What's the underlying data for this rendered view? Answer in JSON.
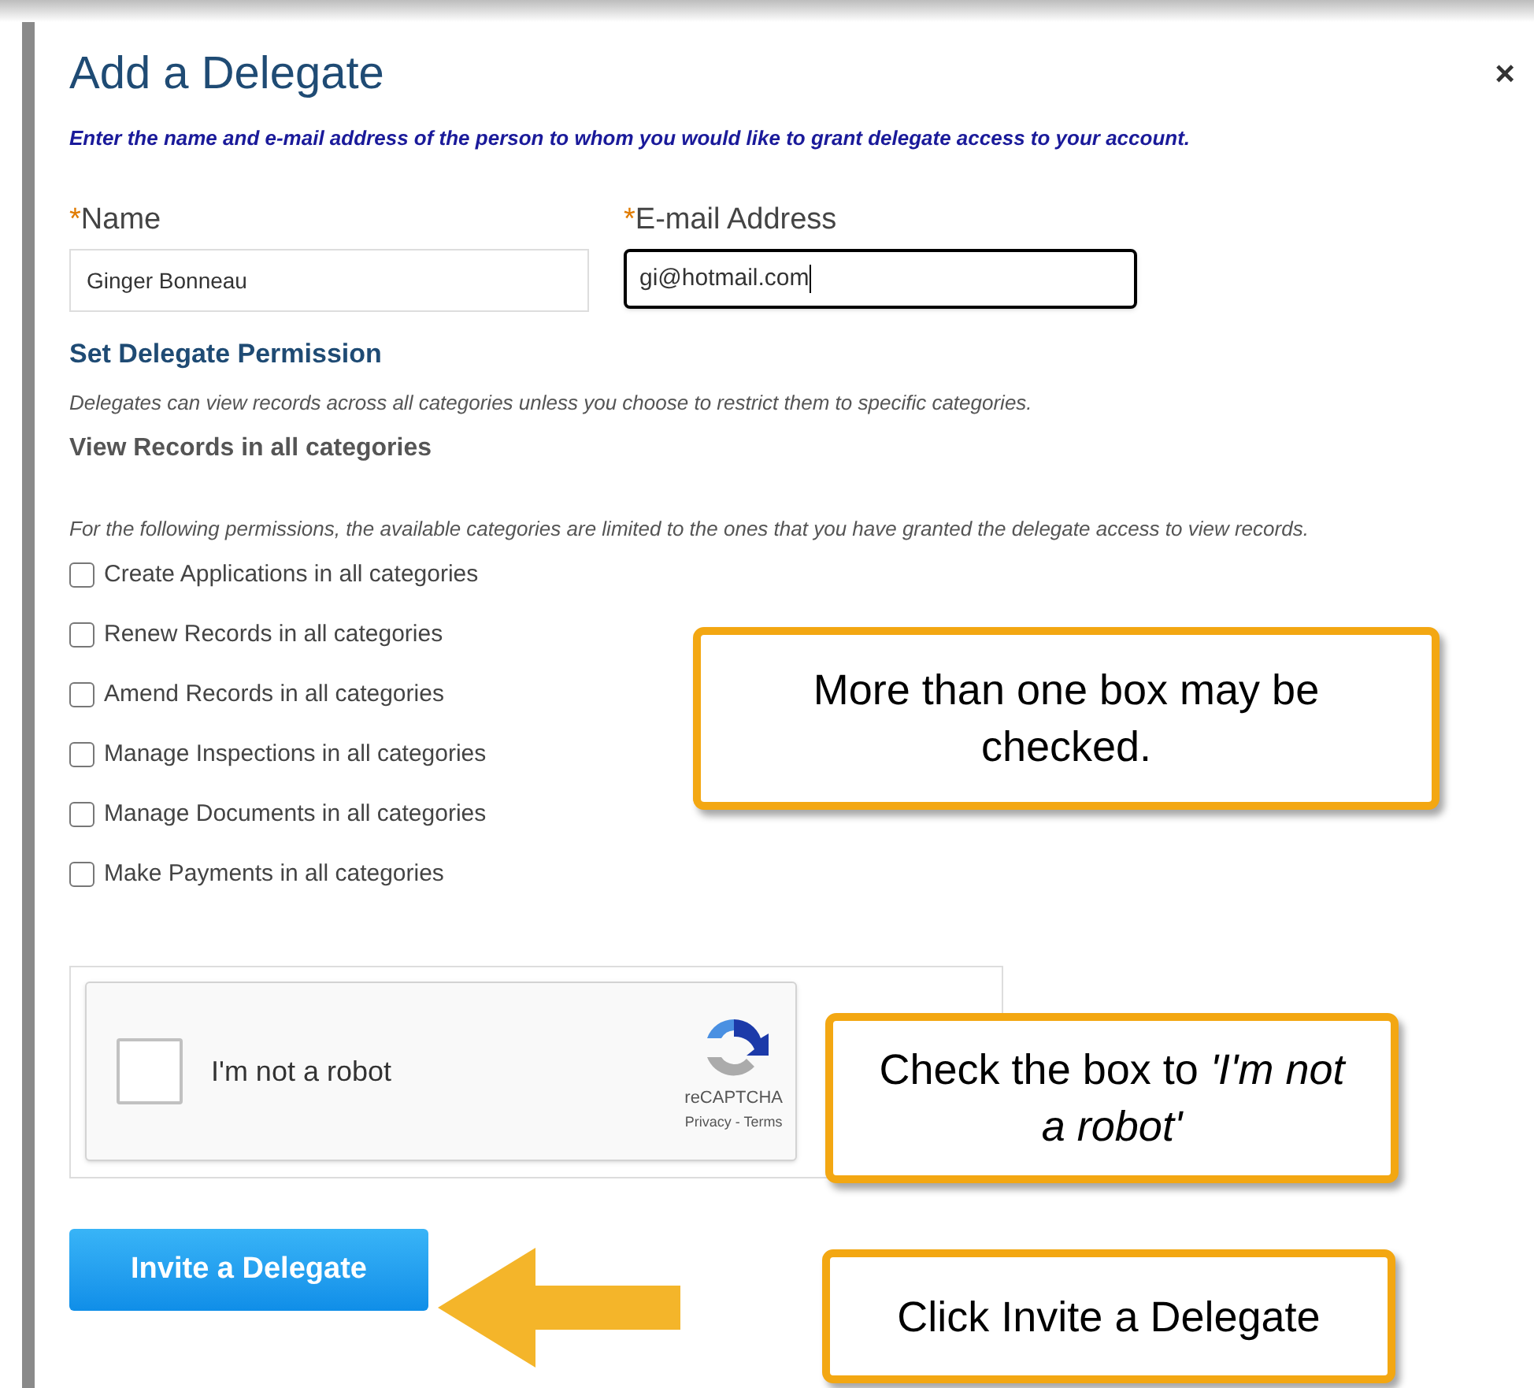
{
  "dialog": {
    "title": "Add a Delegate",
    "close": "×",
    "intro": "Enter the name and e-mail address of the person to whom you would like to grant delegate access to your account.",
    "fields": [
      {
        "label": "Name",
        "required_mark": "*",
        "value": "Ginger Bonneau",
        "focused": false
      },
      {
        "label": "E-mail Address",
        "required_mark": "*",
        "value": "gi@hotmail.com",
        "focused": true
      }
    ],
    "permission_heading": "Set Delegate Permission",
    "permission_note": "Delegates can view records across all categories unless you choose to restrict them to specific categories.",
    "view_records": "View Records in all categories",
    "following_note": "For the following permissions, the available categories are limited to the ones that you have granted the delegate access to view records.",
    "permissions": [
      {
        "label": "Create Applications in all categories",
        "checked": false
      },
      {
        "label": "Renew Records in all categories",
        "checked": false
      },
      {
        "label": "Amend Records in all categories",
        "checked": false
      },
      {
        "label": "Manage Inspections in all categories",
        "checked": false
      },
      {
        "label": "Manage Documents in all categories",
        "checked": false
      },
      {
        "label": "Make Payments in all categories",
        "checked": false
      }
    ],
    "captcha": {
      "label": "I'm not a robot",
      "checked": false,
      "brand": "reCAPTCHA",
      "links": "Privacy - Terms"
    },
    "submit": "Invite a Delegate"
  },
  "callouts": [
    {
      "text": "More than one box may be checked."
    },
    {
      "text": "Check the box to *'I'm not a robot'*"
    },
    {
      "text": "Click Invite a Delegate"
    }
  ]
}
